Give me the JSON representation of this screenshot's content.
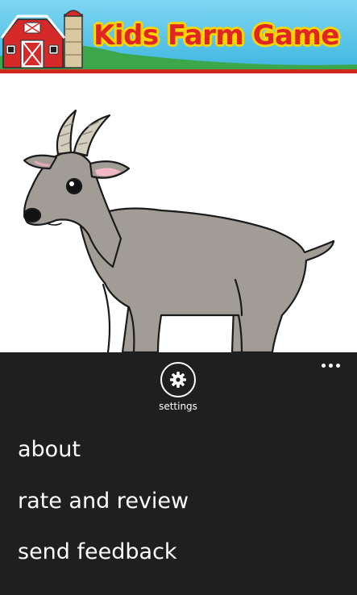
{
  "header": {
    "title": "Kids Farm Game",
    "title_color": "#e12424",
    "title_outline_color": "#ffd500",
    "sky_color": "#5ec8e8",
    "grass_color": "#3ba64a",
    "accent_line_color": "#d0281c",
    "logo_icon": "barn-silo-icon"
  },
  "main": {
    "image_icon": "goat-illustration"
  },
  "appbar": {
    "background": "#1f1f1f",
    "more_icon": "ellipsis-icon",
    "settings_icon": "gear-icon",
    "settings_label": "settings",
    "menu_items": [
      {
        "label": "about"
      },
      {
        "label": "rate and review"
      },
      {
        "label": "send feedback"
      }
    ]
  }
}
